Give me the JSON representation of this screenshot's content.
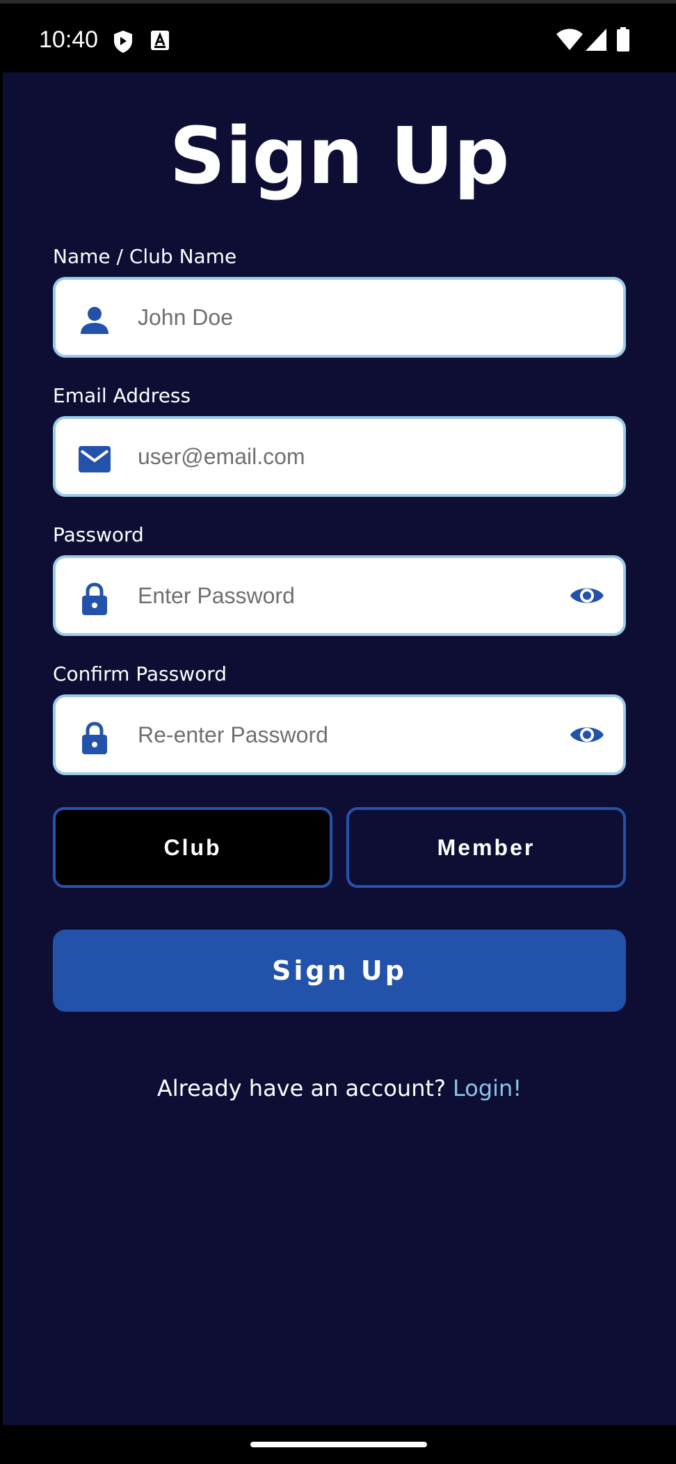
{
  "status_bar": {
    "time": "10:40",
    "icons": [
      "shield-icon",
      "a-box-icon",
      "wifi-icon",
      "signal-icon",
      "battery-icon"
    ]
  },
  "page": {
    "title": "Sign Up"
  },
  "form": {
    "name": {
      "label": "Name / Club Name",
      "placeholder": "John Doe",
      "icon": "person-icon"
    },
    "email": {
      "label": "Email Address",
      "placeholder": "user@email.com",
      "icon": "mail-icon"
    },
    "password": {
      "label": "Password",
      "placeholder": "Enter Password",
      "icon": "lock-icon",
      "toggle_icon": "eye-icon"
    },
    "confirm_password": {
      "label": "Confirm Password",
      "placeholder": "Re-enter Password",
      "icon": "lock-icon",
      "toggle_icon": "eye-icon"
    }
  },
  "role": {
    "options": [
      "Club",
      "Member"
    ],
    "selected": "Club"
  },
  "actions": {
    "submit_label": "Sign Up",
    "login_prompt": "Already have an account?",
    "login_link": "Login!"
  },
  "colors": {
    "background": "#0e0e35",
    "primary": "#2352aa",
    "field_border": "#9bcbea",
    "link": "#8cc4ea",
    "icon": "#2352aa"
  }
}
